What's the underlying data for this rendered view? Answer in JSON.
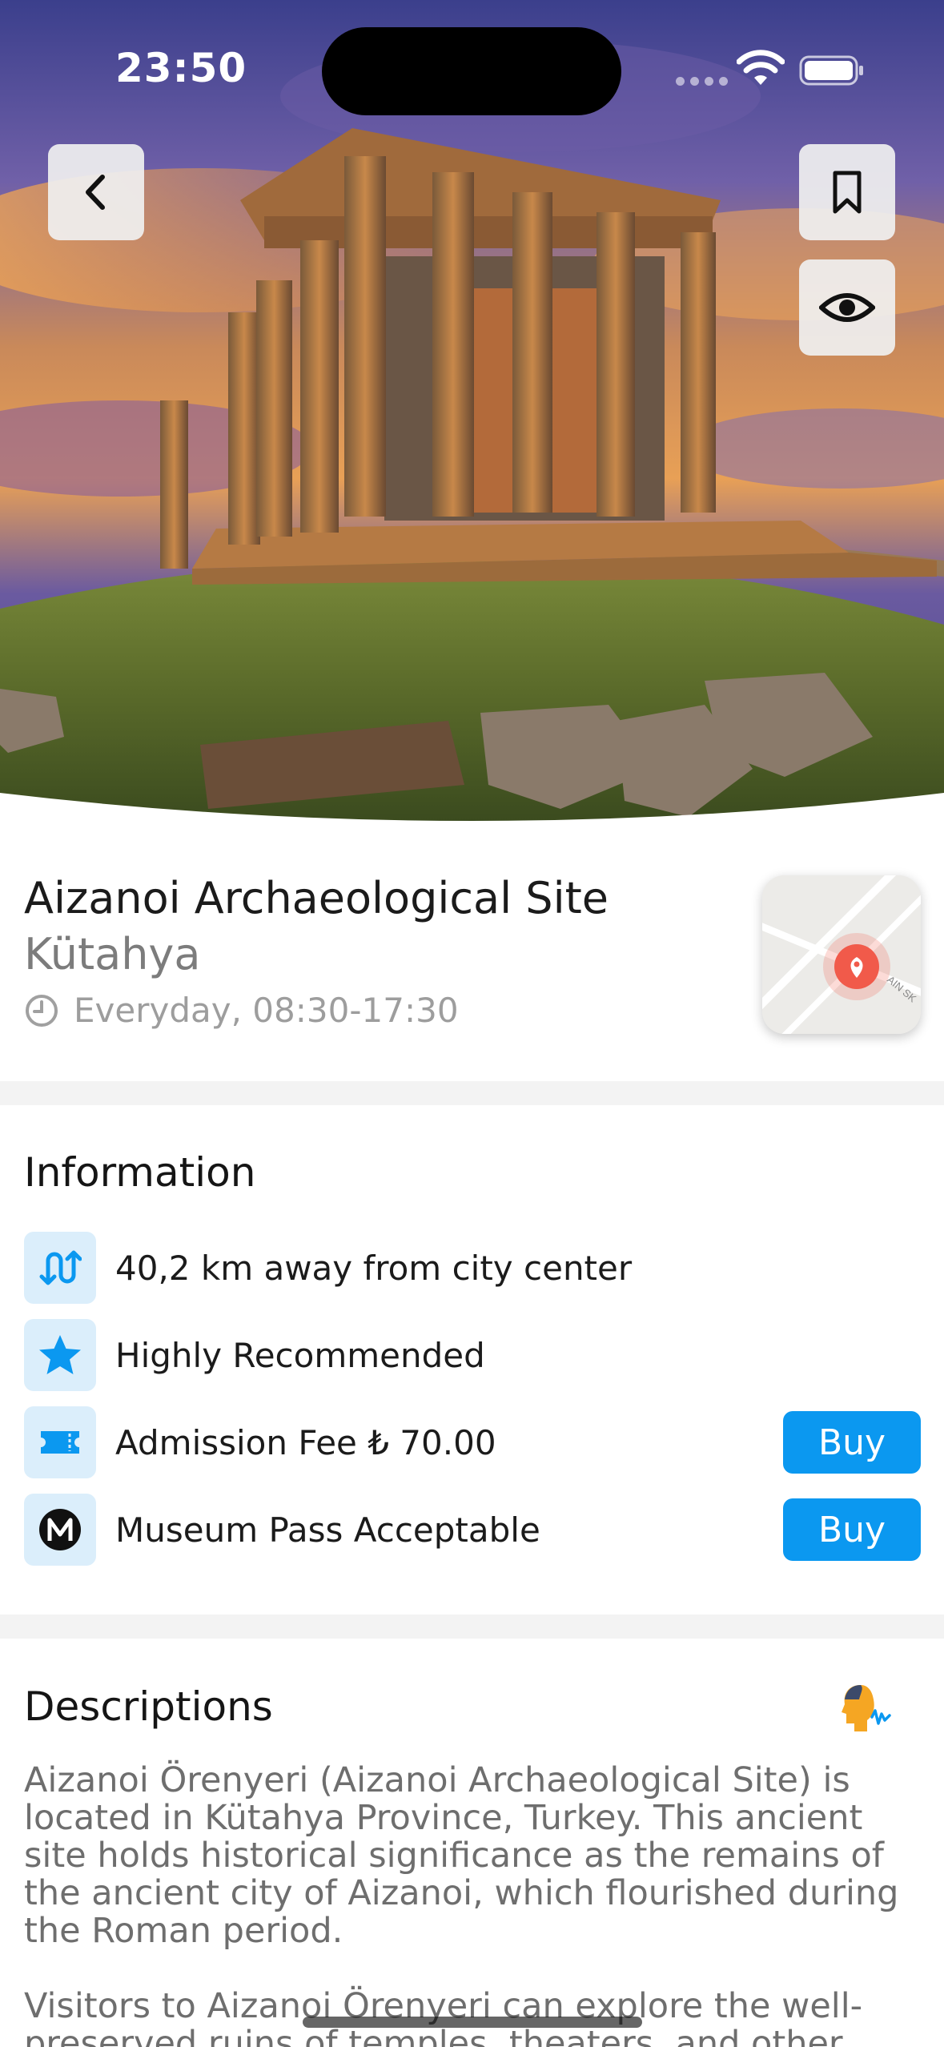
{
  "status_bar": {
    "time": "23:50"
  },
  "hero": {
    "image_alt": "Temple of Zeus ruins at sunset"
  },
  "place": {
    "title": "Aizanoi Archaeological Site",
    "city": "Kütahya",
    "hours": "Everyday, 08:30-17:30"
  },
  "map_thumb": {
    "street_label": "AIN SK"
  },
  "information": {
    "title": "Information",
    "items": [
      {
        "icon": "route-icon",
        "text": "40,2 km away from city center"
      },
      {
        "icon": "star-icon",
        "text": "Highly Recommended"
      },
      {
        "icon": "ticket-icon",
        "text": "Admission Fee ₺ 70.00",
        "button": "Buy"
      },
      {
        "icon": "museum-pass-icon",
        "text": "Museum Pass Acceptable",
        "button": "Buy"
      }
    ]
  },
  "descriptions": {
    "title": "Descriptions",
    "paragraphs": [
      "Aizanoi Örenyeri (Aizanoi Archaeological Site) is located in Kütahya Province, Turkey. This ancient site holds historical significance as the remains of the ancient city of Aizanoi, which flourished during the Roman period.",
      "Visitors to Aizanoi Örenyeri can explore the well-preserved ruins of temples, theaters, and other"
    ]
  },
  "colors": {
    "accent": "#0b98f0",
    "icon_bg": "#dbeefb",
    "divider": "#f3f3f3",
    "pin": "#f15a4a"
  }
}
